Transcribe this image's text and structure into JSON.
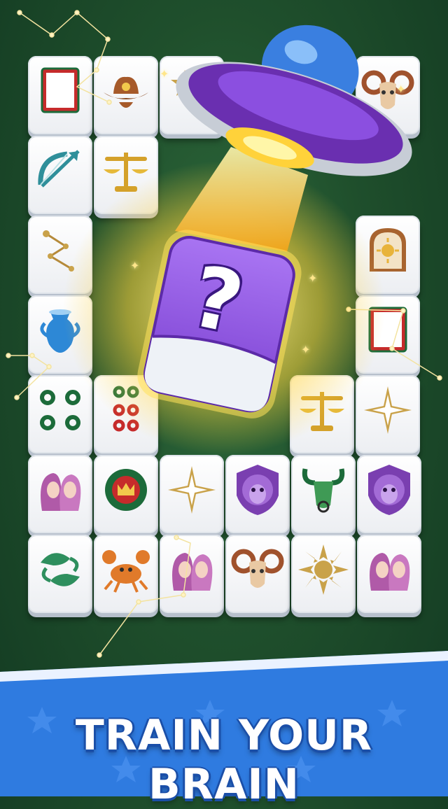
{
  "banner": {
    "title": "TRAIN YOUR BRAIN"
  },
  "mystery_tile": {
    "symbol": "?",
    "accent": "#8b4fe0"
  },
  "colors": {
    "board_bg": "#1f4f2c",
    "tile_face": "#ffffff",
    "banner_blue": "#2f7be0",
    "glow": "#ffd23a",
    "ufo_purple": "#6a2fb0"
  },
  "tiles": [
    {
      "icon": "red-frame-icon"
    },
    {
      "icon": "cowboy-hat-icon"
    },
    {
      "icon": "star-tile-icon"
    },
    {
      "icon": "ram-head-icon"
    },
    {
      "icon": "sagittarius-bow-icon"
    },
    {
      "icon": "libra-scales-icon"
    },
    {
      "icon": "constellation-tile-icon"
    },
    {
      "icon": "sun-window-icon"
    },
    {
      "icon": "aquarius-vase-icon"
    },
    {
      "icon": "red-frame-icon"
    },
    {
      "icon": "four-circles-icon"
    },
    {
      "icon": "eight-dots-icon"
    },
    {
      "icon": "libra-scales-icon"
    },
    {
      "icon": "compass-star-icon"
    },
    {
      "icon": "gemini-faces-icon"
    },
    {
      "icon": "crown-circle-icon"
    },
    {
      "icon": "compass-star-icon"
    },
    {
      "icon": "leo-lion-icon"
    },
    {
      "icon": "taurus-bull-icon"
    },
    {
      "icon": "leo-lion-icon"
    },
    {
      "icon": "pisces-fish-icon"
    },
    {
      "icon": "cancer-crab-icon"
    },
    {
      "icon": "gemini-faces-icon"
    },
    {
      "icon": "ram-head-icon"
    },
    {
      "icon": "sun-icon"
    },
    {
      "icon": "gemini-faces-icon"
    }
  ]
}
